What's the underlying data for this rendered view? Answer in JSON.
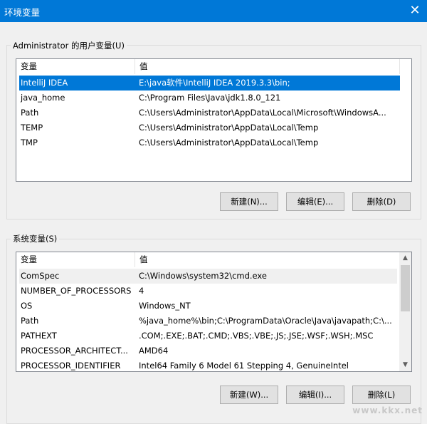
{
  "window": {
    "title": "环境变量",
    "close_icon": "close-icon"
  },
  "user_vars": {
    "legend": "Administrator 的用户变量(U)",
    "columns": [
      "变量",
      "值"
    ],
    "rows": [
      {
        "name": "IntelliJ IDEA",
        "value": "E:\\java软件\\IntelliJ IDEA 2019.3.3\\bin;"
      },
      {
        "name": "java_home",
        "value": "C:\\Program Files\\Java\\jdk1.8.0_121"
      },
      {
        "name": "Path",
        "value": "C:\\Users\\Administrator\\AppData\\Local\\Microsoft\\WindowsA..."
      },
      {
        "name": "TEMP",
        "value": "C:\\Users\\Administrator\\AppData\\Local\\Temp"
      },
      {
        "name": "TMP",
        "value": "C:\\Users\\Administrator\\AppData\\Local\\Temp"
      }
    ],
    "buttons": {
      "new": "新建(N)...",
      "edit": "编辑(E)...",
      "delete": "删除(D)"
    }
  },
  "system_vars": {
    "legend": "系统变量(S)",
    "columns": [
      "变量",
      "值"
    ],
    "rows": [
      {
        "name": "ComSpec",
        "value": "C:\\Windows\\system32\\cmd.exe"
      },
      {
        "name": "NUMBER_OF_PROCESSORS",
        "value": "4"
      },
      {
        "name": "OS",
        "value": "Windows_NT"
      },
      {
        "name": "Path",
        "value": "%java_home%\\bin;C:\\ProgramData\\Oracle\\Java\\javapath;C:\\..."
      },
      {
        "name": "PATHEXT",
        "value": ".COM;.EXE;.BAT;.CMD;.VBS;.VBE;.JS;.JSE;.WSF;.WSH;.MSC"
      },
      {
        "name": "PROCESSOR_ARCHITECT...",
        "value": "AMD64"
      },
      {
        "name": "PROCESSOR_IDENTIFIER",
        "value": "Intel64 Family 6 Model 61 Stepping 4, GenuineIntel"
      }
    ],
    "buttons": {
      "new": "新建(W)...",
      "edit": "编辑(I)...",
      "delete": "删除(L)"
    }
  },
  "watermark": "www.kkx.net"
}
